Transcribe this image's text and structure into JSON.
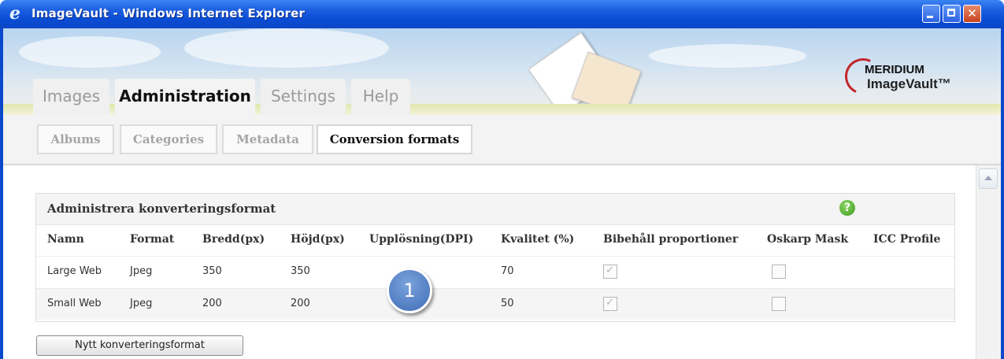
{
  "window": {
    "title": "ImageVault - Windows Internet Explorer",
    "buttons": {
      "minimize": "minimize",
      "maximize": "maximize",
      "close": "✕"
    }
  },
  "logo": {
    "line1": "MERIDIUM",
    "line2": "ImageVault™"
  },
  "tabs": [
    {
      "label": "Images",
      "active": false
    },
    {
      "label": "Administration",
      "active": true
    },
    {
      "label": "Settings",
      "active": false
    },
    {
      "label": "Help",
      "active": false
    }
  ],
  "subtabs": [
    {
      "label": "Albums",
      "active": false
    },
    {
      "label": "Categories",
      "active": false
    },
    {
      "label": "Metadata",
      "active": false
    },
    {
      "label": "Conversion formats",
      "active": true
    }
  ],
  "panel": {
    "title": "Administrera konverteringsformat",
    "help_icon": "?",
    "columns": [
      "Namn",
      "Format",
      "Bredd(px)",
      "Höjd(px)",
      "Upplösning(DPI)",
      "Kvalitet (%)",
      "Bibehåll proportioner",
      "Oskarp Mask",
      "ICC Profile"
    ],
    "rows": [
      {
        "name": "Large Web",
        "format": "Jpeg",
        "width": "350",
        "height": "350",
        "dpi": "",
        "quality": "70",
        "keep_proportions": true,
        "unsharp_mask": false,
        "icc": ""
      },
      {
        "name": "Small Web",
        "format": "Jpeg",
        "width": "200",
        "height": "200",
        "dpi": "",
        "quality": "50",
        "keep_proportions": true,
        "unsharp_mask": false,
        "icc": ""
      }
    ]
  },
  "badge": "1",
  "new_button": "Nytt konverteringsformat",
  "colors": {
    "titlebar": "#0a4cd4",
    "badge": "#4a78c0",
    "help": "#4aa82a"
  }
}
